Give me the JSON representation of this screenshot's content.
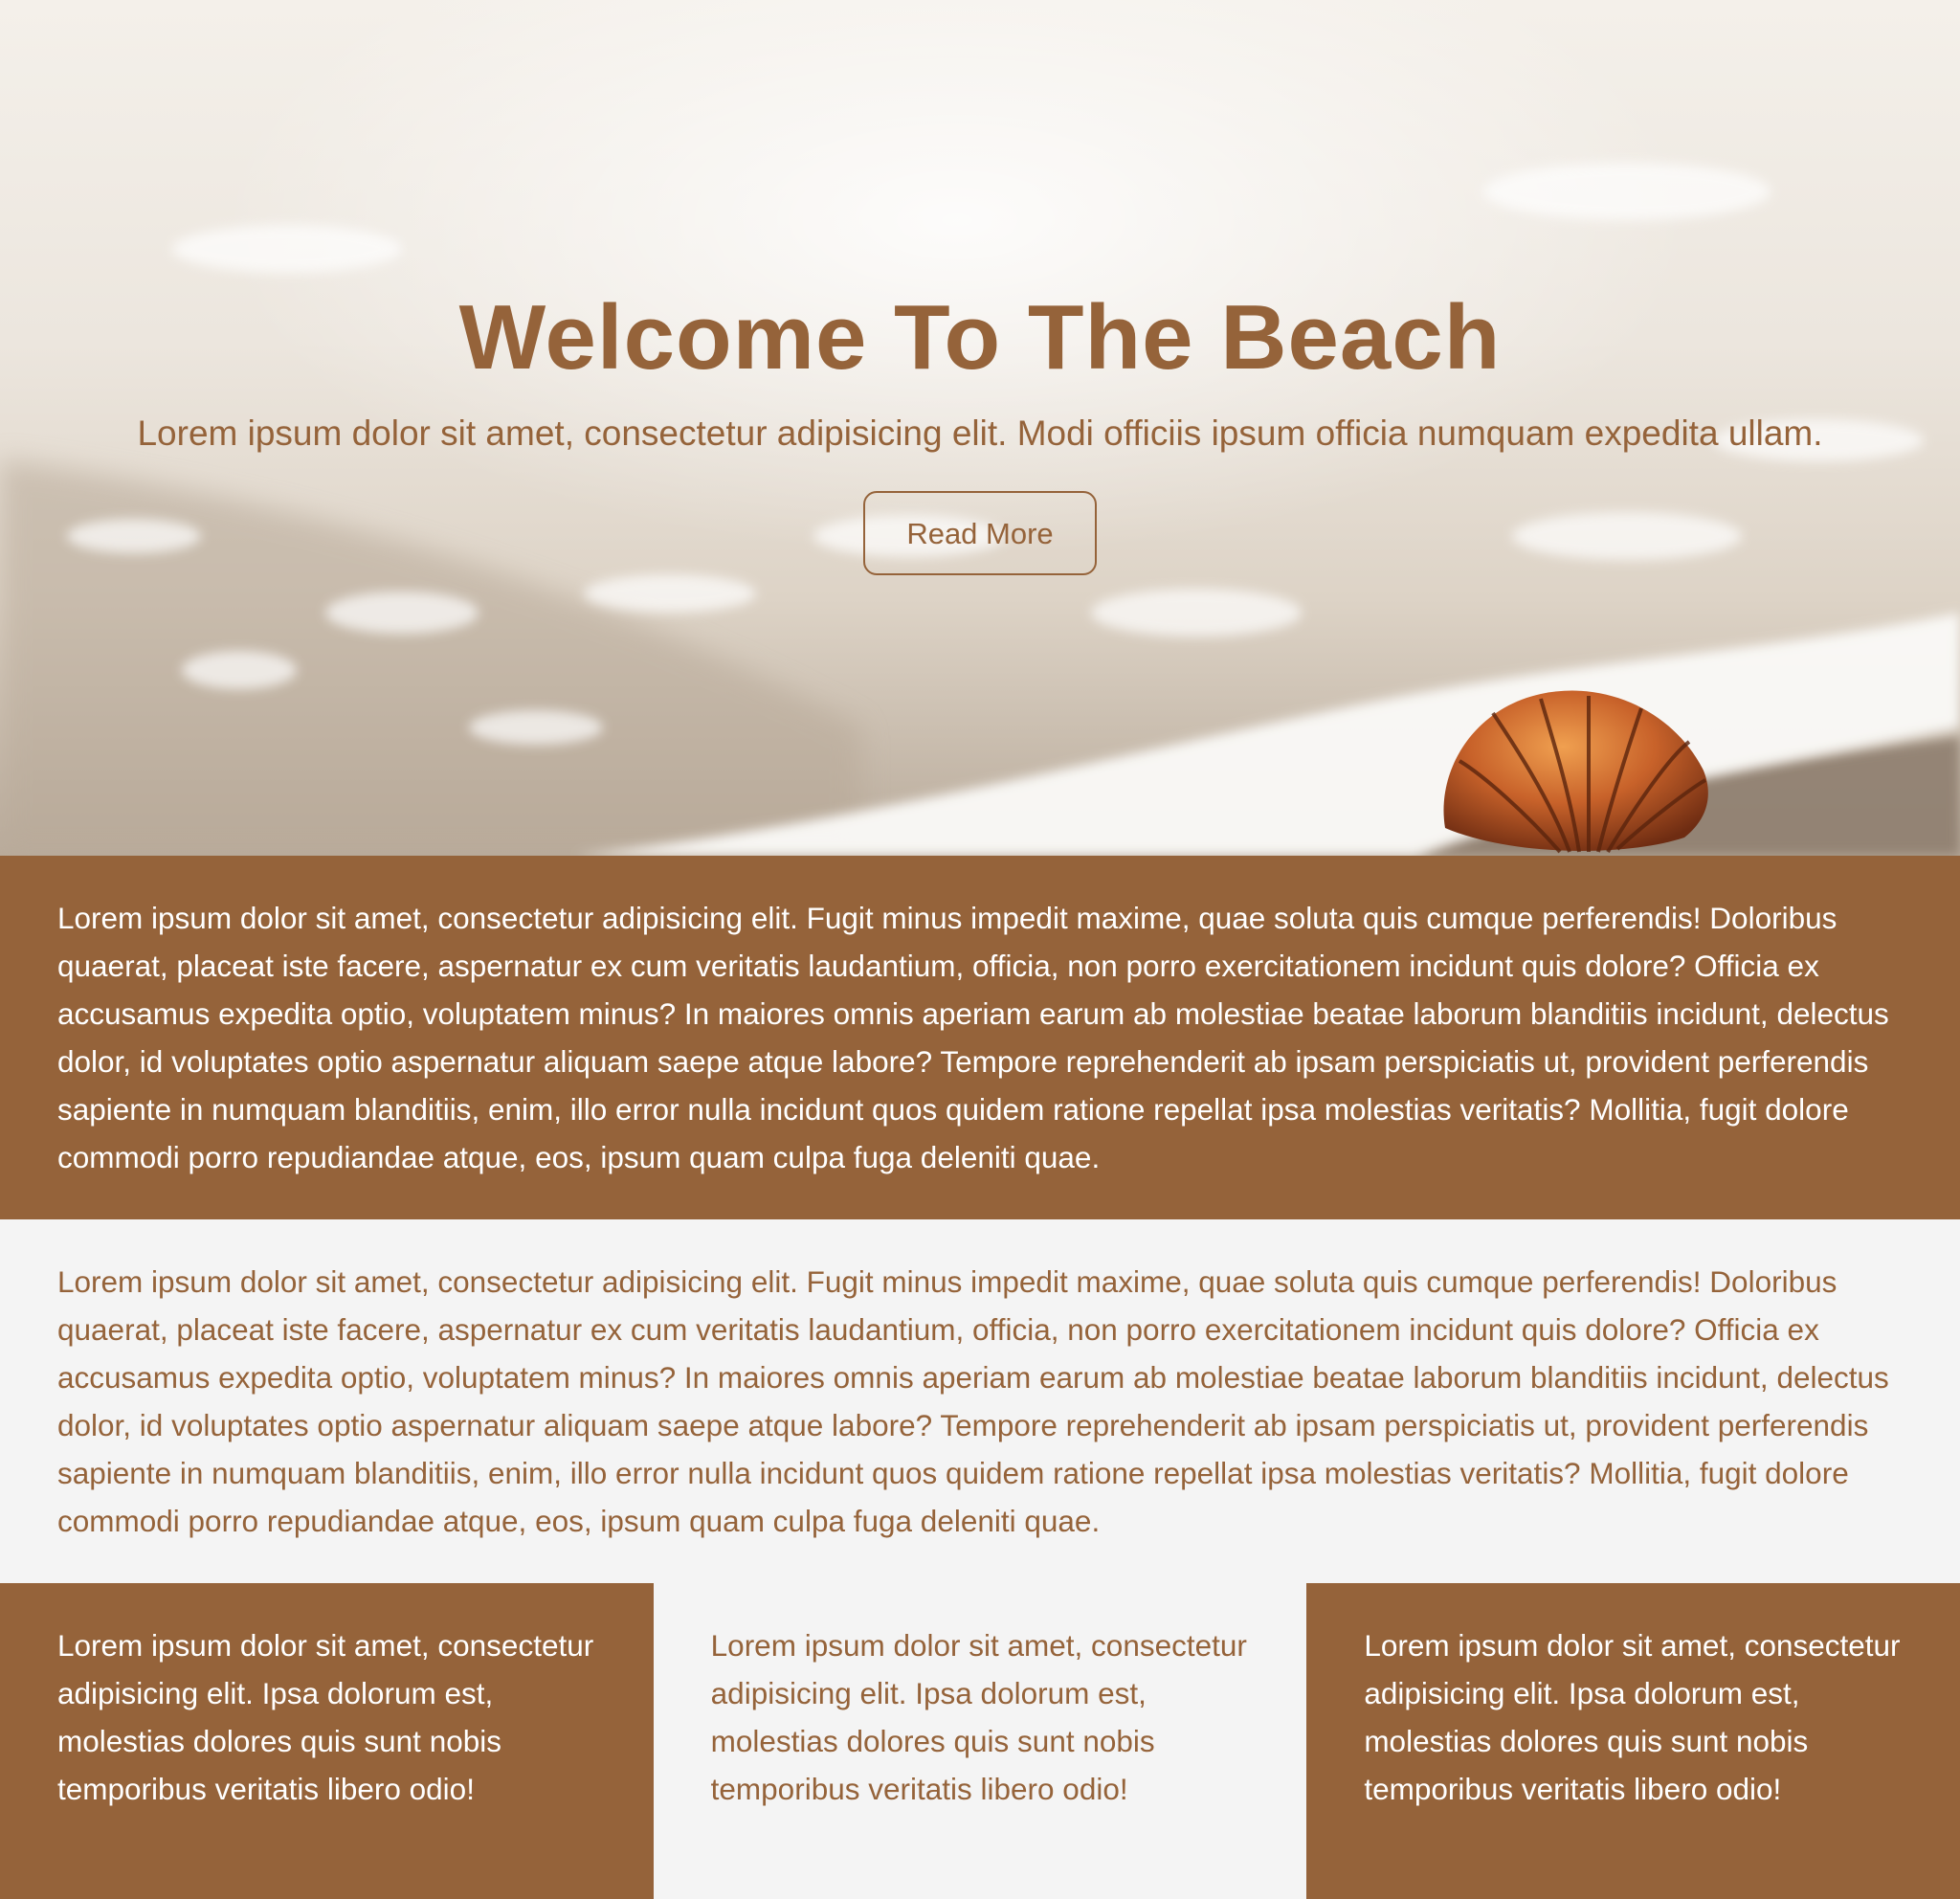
{
  "hero": {
    "title": "Welcome To The Beach",
    "subtitle": "Lorem ipsum dolor sit amet, consectetur adipisicing elit. Modi officiis ipsum officia numquam expedita ullam.",
    "button_label": "Read More"
  },
  "sections": {
    "brown_text": "Lorem ipsum dolor sit amet, consectetur adipisicing elit. Fugit minus impedit maxime, quae soluta quis cumque perferendis! Doloribus quaerat, placeat iste facere, aspernatur ex cum veritatis laudantium, officia, non porro exercitationem incidunt quis dolore? Officia ex accusamus expedita optio, voluptatem minus? In maiores omnis aperiam earum ab molestiae beatae laborum blanditiis incidunt, delectus dolor, id voluptates optio aspernatur aliquam saepe atque labore? Tempore reprehenderit ab ipsam perspiciatis ut, provident perferendis sapiente in numquam blanditiis, enim, illo error nulla incidunt quos quidem ratione repellat ipsa molestias veritatis? Mollitia, fugit dolore commodi porro repudiandae atque, eos, ipsum quam culpa fuga deleniti quae.",
    "light_text": "Lorem ipsum dolor sit amet, consectetur adipisicing elit. Fugit minus impedit maxime, quae soluta quis cumque perferendis! Doloribus quaerat, placeat iste facere, aspernatur ex cum veritatis laudantium, officia, non porro exercitationem incidunt quis dolore? Officia ex accusamus expedita optio, voluptatem minus? In maiores omnis aperiam earum ab molestiae beatae laborum blanditiis incidunt, delectus dolor, id voluptates optio aspernatur aliquam saepe atque labore? Tempore reprehenderit ab ipsam perspiciatis ut, provident perferendis sapiente in numquam blanditiis, enim, illo error nulla incidunt quos quidem ratione repellat ipsa molestias veritatis? Mollitia, fugit dolore commodi porro repudiandae atque, eos, ipsum quam culpa fuga deleniti quae."
  },
  "columns": [
    {
      "text": "Lorem ipsum dolor sit amet, consectetur adipisicing elit. Ipsa dolorum est, molestias dolores quis sunt nobis temporibus veritatis libero odio!"
    },
    {
      "text": "Lorem ipsum dolor sit amet, consectetur adipisicing elit. Ipsa dolorum est, molestias dolores quis sunt nobis temporibus veritatis libero odio!"
    },
    {
      "text": "Lorem ipsum dolor sit amet, consectetur adipisicing elit. Ipsa dolorum est, molestias dolores quis sunt nobis temporibus veritatis libero odio!"
    }
  ],
  "colors": {
    "brand_brown": "#95633a",
    "light_background": "#f4f4f4",
    "white": "#ffffff"
  },
  "icons": {
    "hero_image": "beach-seashell-image"
  }
}
